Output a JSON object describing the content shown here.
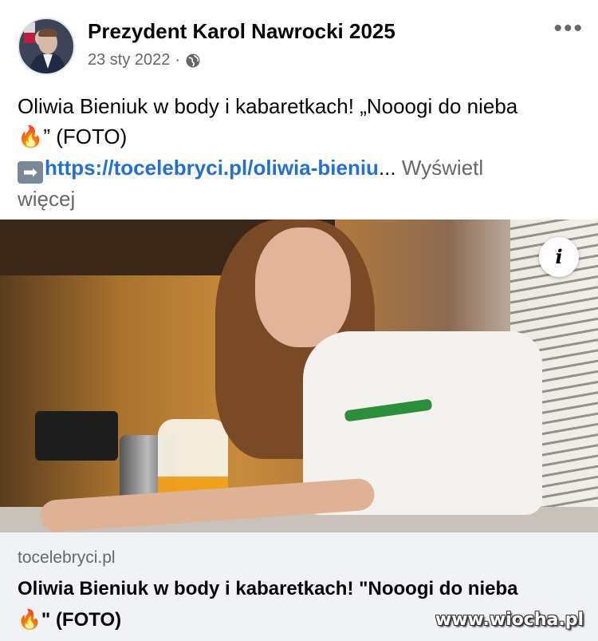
{
  "post": {
    "author": "Prezydent Karol Nawrocki 2025",
    "date": "23 sty 2022",
    "separator": "·",
    "privacy_icon": "globe-icon",
    "more_icon": "more-options-icon",
    "more_glyph": "•••",
    "text_line1": "Oliwia Bieniuk w body i kabaretkach! „Nooogi do nieba",
    "emoji": "🔥",
    "text_line2": "” (FOTO)",
    "arrow_glyph": "➡",
    "link_text": "https://tocelebryci.pl/oliwia-bieniu",
    "ellipsis": "...",
    "see_more_1": "Wyświetl",
    "see_more_2": "więcej"
  },
  "media": {
    "info_icon": "info-icon",
    "info_glyph": "i"
  },
  "link_preview": {
    "domain": "tocelebryci.pl",
    "title_line1": "Oliwia Bieniuk w body i kabaretkach! \"Nooogi do nieba",
    "emoji": "🔥",
    "title_line2": "\" (FOTO)"
  },
  "watermark": "www.wiocha.pl"
}
